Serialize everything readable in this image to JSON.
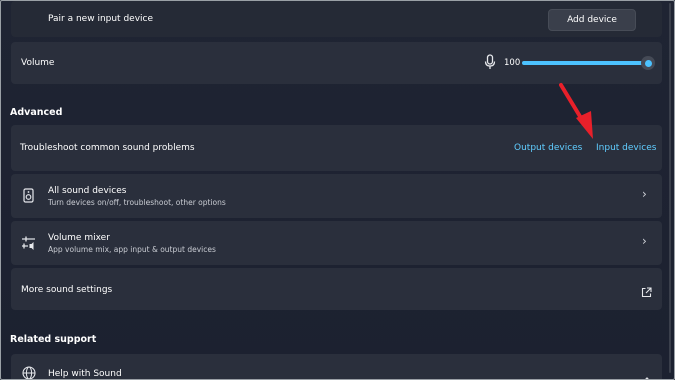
{
  "top_row": {
    "label": "Pair a new input device",
    "button": "Add device"
  },
  "volume": {
    "label": "Volume",
    "value": "100",
    "level": 1.0
  },
  "advanced": {
    "heading": "Advanced",
    "troubleshoot": {
      "label": "Troubleshoot common sound problems",
      "link_output": "Output devices",
      "link_input": "Input devices"
    },
    "all_devices": {
      "title": "All sound devices",
      "subtitle": "Turn devices on/off, troubleshoot, other options"
    },
    "mixer": {
      "title": "Volume mixer",
      "subtitle": "App volume mix, app input & output devices"
    },
    "more_settings": {
      "label": "More sound settings"
    }
  },
  "related": {
    "heading": "Related support",
    "help": {
      "label": "Help with Sound"
    }
  },
  "colors": {
    "accent": "#60cdff",
    "slider": "#4cc2ff",
    "arrow": "#e8202a"
  }
}
